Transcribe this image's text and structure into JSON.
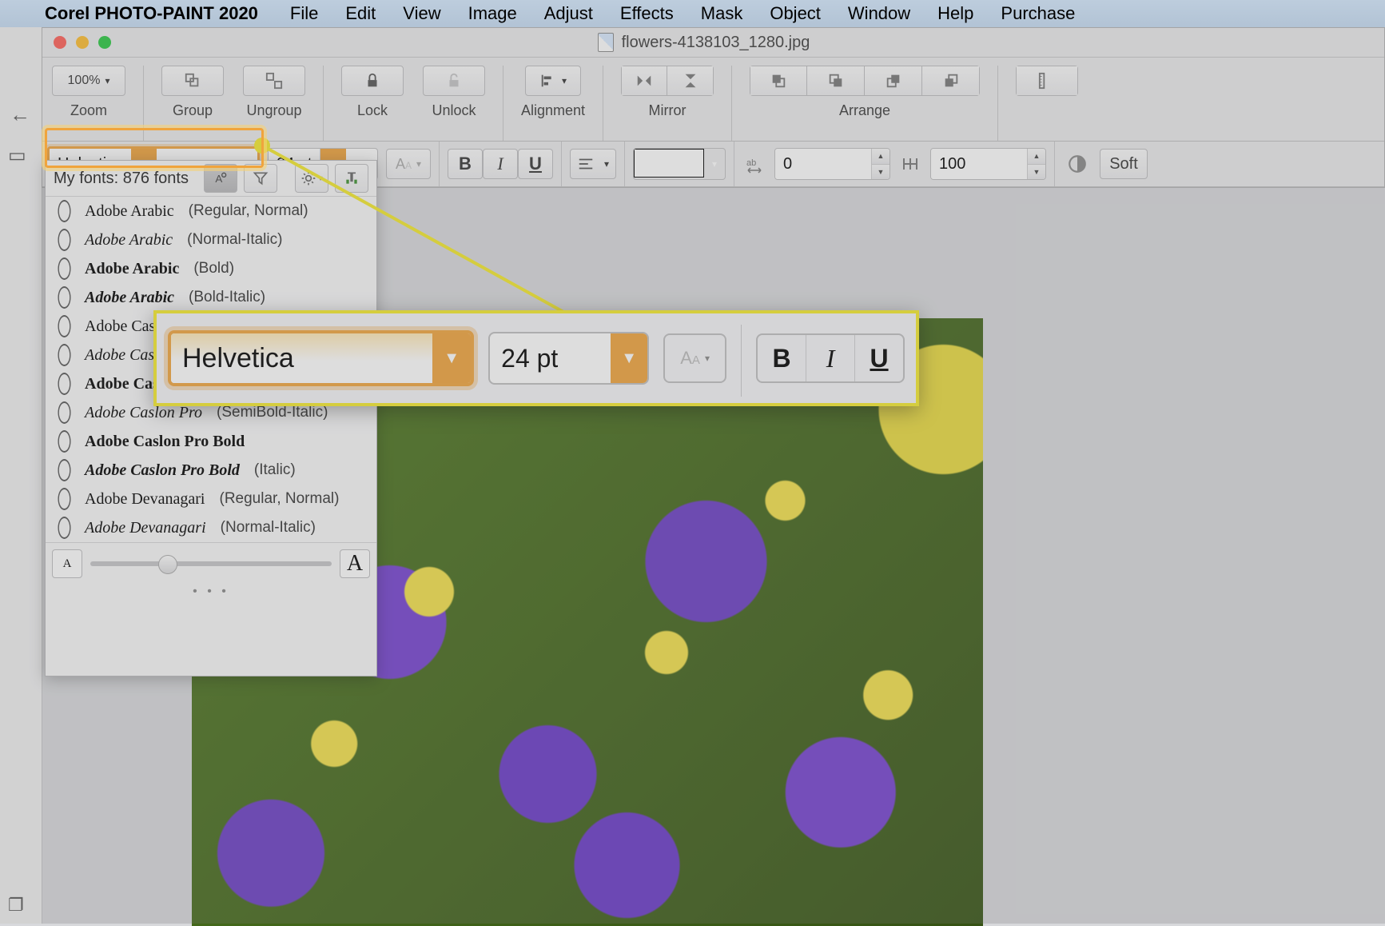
{
  "menubar": {
    "app_name": "Corel PHOTO-PAINT 2020",
    "items": [
      "File",
      "Edit",
      "View",
      "Image",
      "Adjust",
      "Effects",
      "Mask",
      "Object",
      "Window",
      "Help",
      "Purchase"
    ]
  },
  "window": {
    "doc_title": "flowers-4138103_1280.jpg"
  },
  "toolbar1": {
    "zoom_value": "100%",
    "zoom_label": "Zoom",
    "group_label": "Group",
    "ungroup_label": "Ungroup",
    "lock_label": "Lock",
    "unlock_label": "Unlock",
    "alignment_label": "Alignment",
    "mirror_label": "Mirror",
    "arrange_label": "Arrange"
  },
  "toolbar2": {
    "font_family": "Helvetica",
    "font_size": "24 pt",
    "kerning_value": "0",
    "tracking_value": "100",
    "antialias_label": "Soft"
  },
  "font_panel": {
    "header": "My fonts: 876 fonts",
    "items": [
      {
        "name": "Adobe Arabic",
        "attr": "(Regular, Normal)",
        "bold": false,
        "italic": false
      },
      {
        "name": "Adobe Arabic",
        "attr": "(Normal-Italic)",
        "bold": false,
        "italic": true
      },
      {
        "name": "Adobe Arabic",
        "attr": "(Bold)",
        "bold": true,
        "italic": false
      },
      {
        "name": "Adobe Arabic",
        "attr": "(Bold-Italic)",
        "bold": true,
        "italic": true
      },
      {
        "name": "Adobe Caslo",
        "attr": "",
        "bold": false,
        "italic": false
      },
      {
        "name": "Adobe Caslon",
        "attr": "",
        "bold": false,
        "italic": true
      },
      {
        "name": "Adobe Caslo",
        "attr": "",
        "bold": true,
        "italic": false
      },
      {
        "name": "Adobe Caslon Pro",
        "attr": "(SemiBold-Italic)",
        "bold": false,
        "italic": true
      },
      {
        "name": "Adobe Caslon Pro Bold",
        "attr": "",
        "bold": true,
        "italic": false
      },
      {
        "name": "Adobe Caslon Pro Bold",
        "attr": "(Italic)",
        "bold": true,
        "italic": true
      },
      {
        "name": "Adobe Devanagari",
        "attr": "(Regular, Normal)",
        "bold": false,
        "italic": false
      },
      {
        "name": "Adobe Devanagari",
        "attr": "(Normal-Italic)",
        "bold": false,
        "italic": true
      }
    ],
    "small_a": "A",
    "large_a": "A"
  },
  "callout": {
    "font_family": "Helvetica",
    "font_size": "24 pt",
    "bold": "B",
    "italic": "I",
    "underline": "U"
  }
}
